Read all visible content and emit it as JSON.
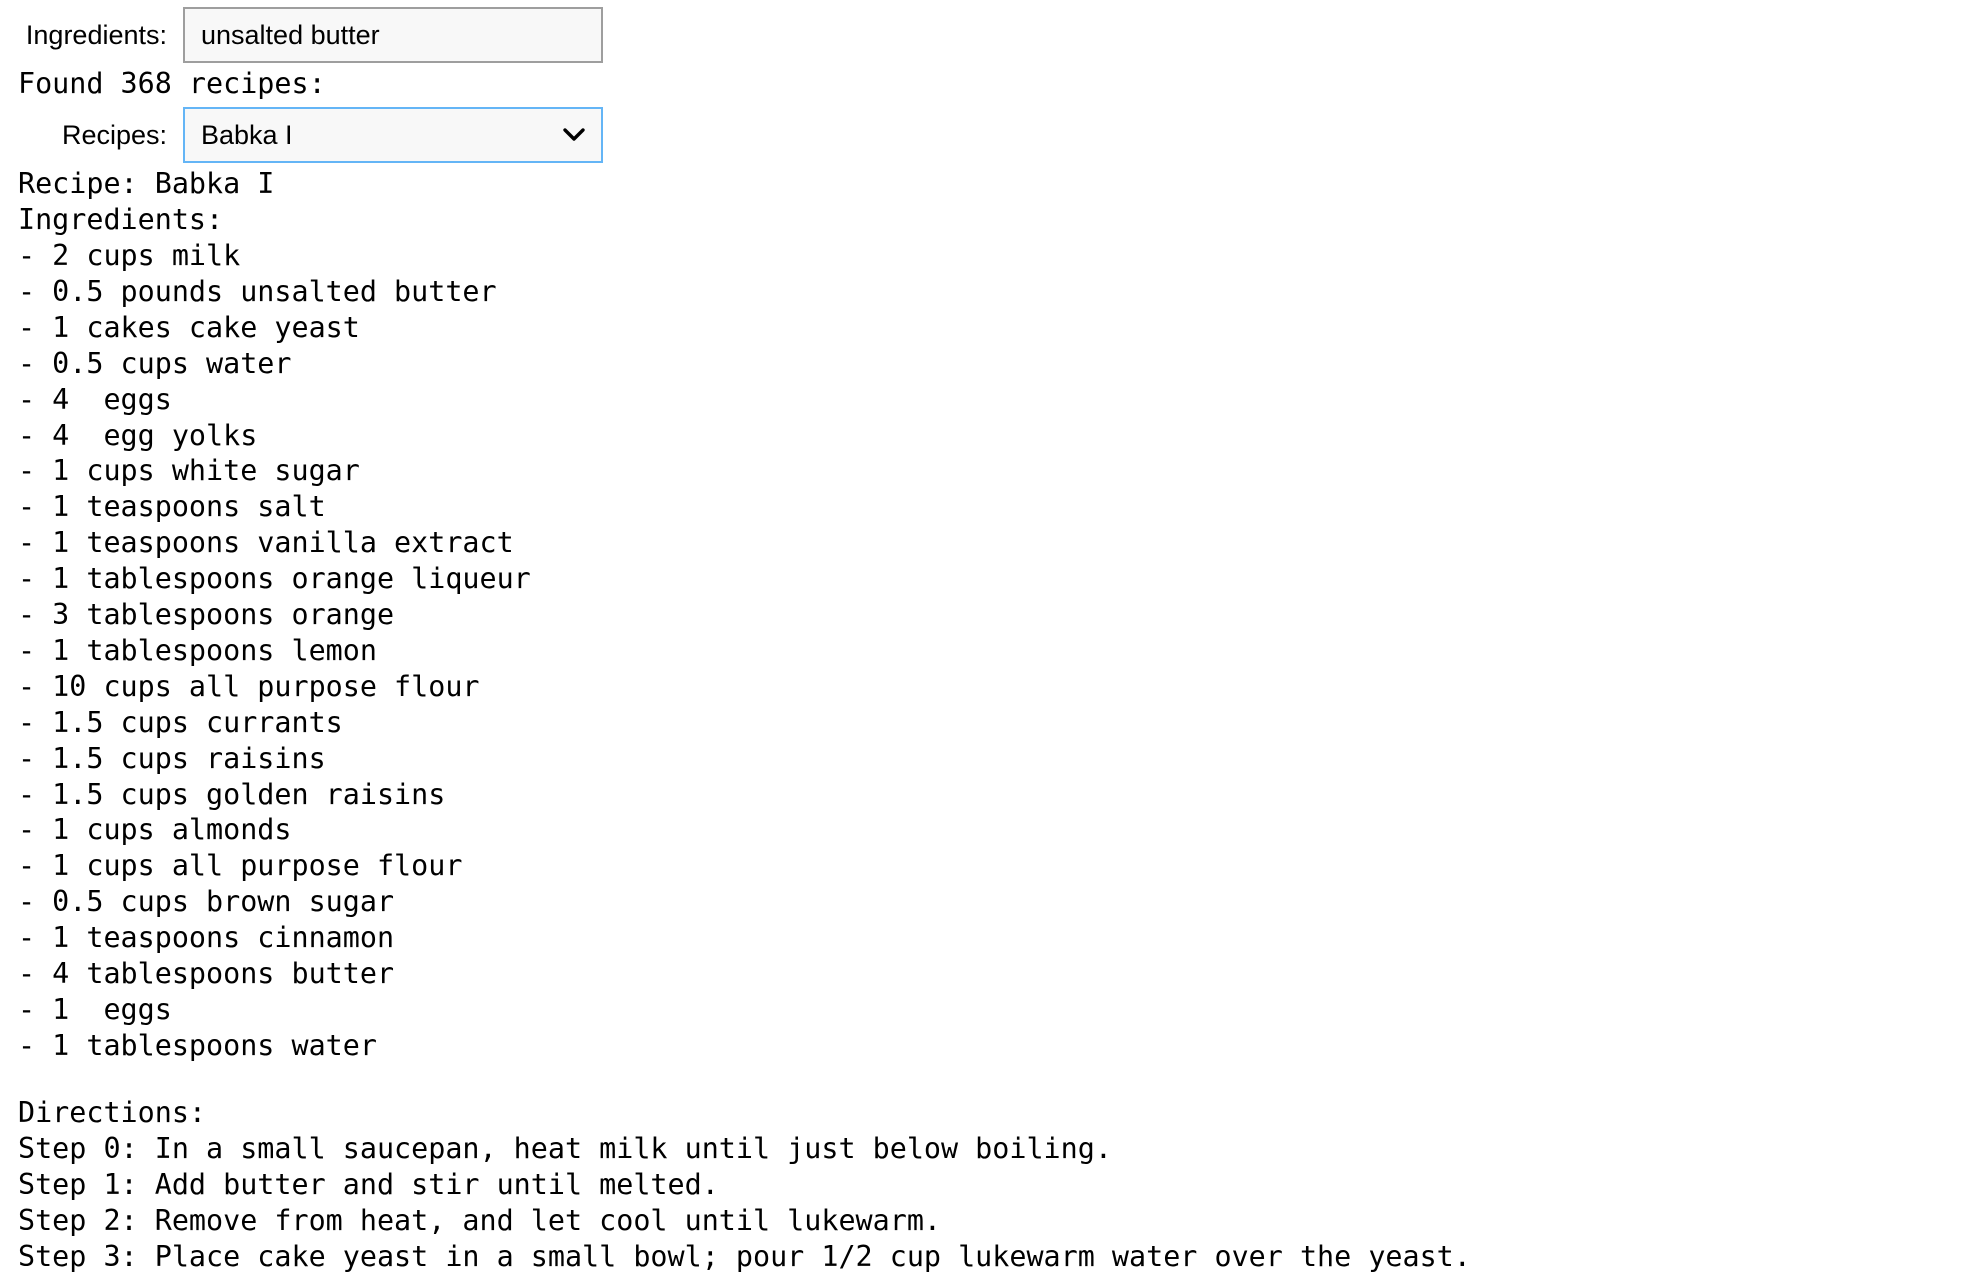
{
  "search": {
    "label": "Ingredients:",
    "value": "unsalted butter"
  },
  "found_text": "Found 368 recipes:",
  "recipes_select": {
    "label": "Recipes:",
    "selected": "Babka I"
  },
  "recipe": {
    "title_line": "Recipe: Babka I",
    "ingredients_header": "Ingredients:",
    "ingredients": [
      "- 2 cups milk",
      "- 0.5 pounds unsalted butter",
      "- 1 cakes cake yeast",
      "- 0.5 cups water",
      "- 4  eggs",
      "- 4  egg yolks",
      "- 1 cups white sugar",
      "- 1 teaspoons salt",
      "- 1 teaspoons vanilla extract",
      "- 1 tablespoons orange liqueur",
      "- 3 tablespoons orange",
      "- 1 tablespoons lemon",
      "- 10 cups all purpose flour",
      "- 1.5 cups currants",
      "- 1.5 cups raisins",
      "- 1.5 cups golden raisins",
      "- 1 cups almonds",
      "- 1 cups all purpose flour",
      "- 0.5 cups brown sugar",
      "- 1 teaspoons cinnamon",
      "- 4 tablespoons butter",
      "- 1  eggs",
      "- 1 tablespoons water"
    ],
    "directions_header": "Directions:",
    "directions": [
      "Step 0: In a small saucepan, heat milk until just below boiling.",
      "Step 1: Add butter and stir until melted.",
      "Step 2: Remove from heat, and let cool until lukewarm.",
      "Step 3: Place cake yeast in a small bowl; pour 1/2 cup lukewarm water over the yeast."
    ]
  },
  "icons": {
    "select_arrow": "chevron-down-icon"
  }
}
